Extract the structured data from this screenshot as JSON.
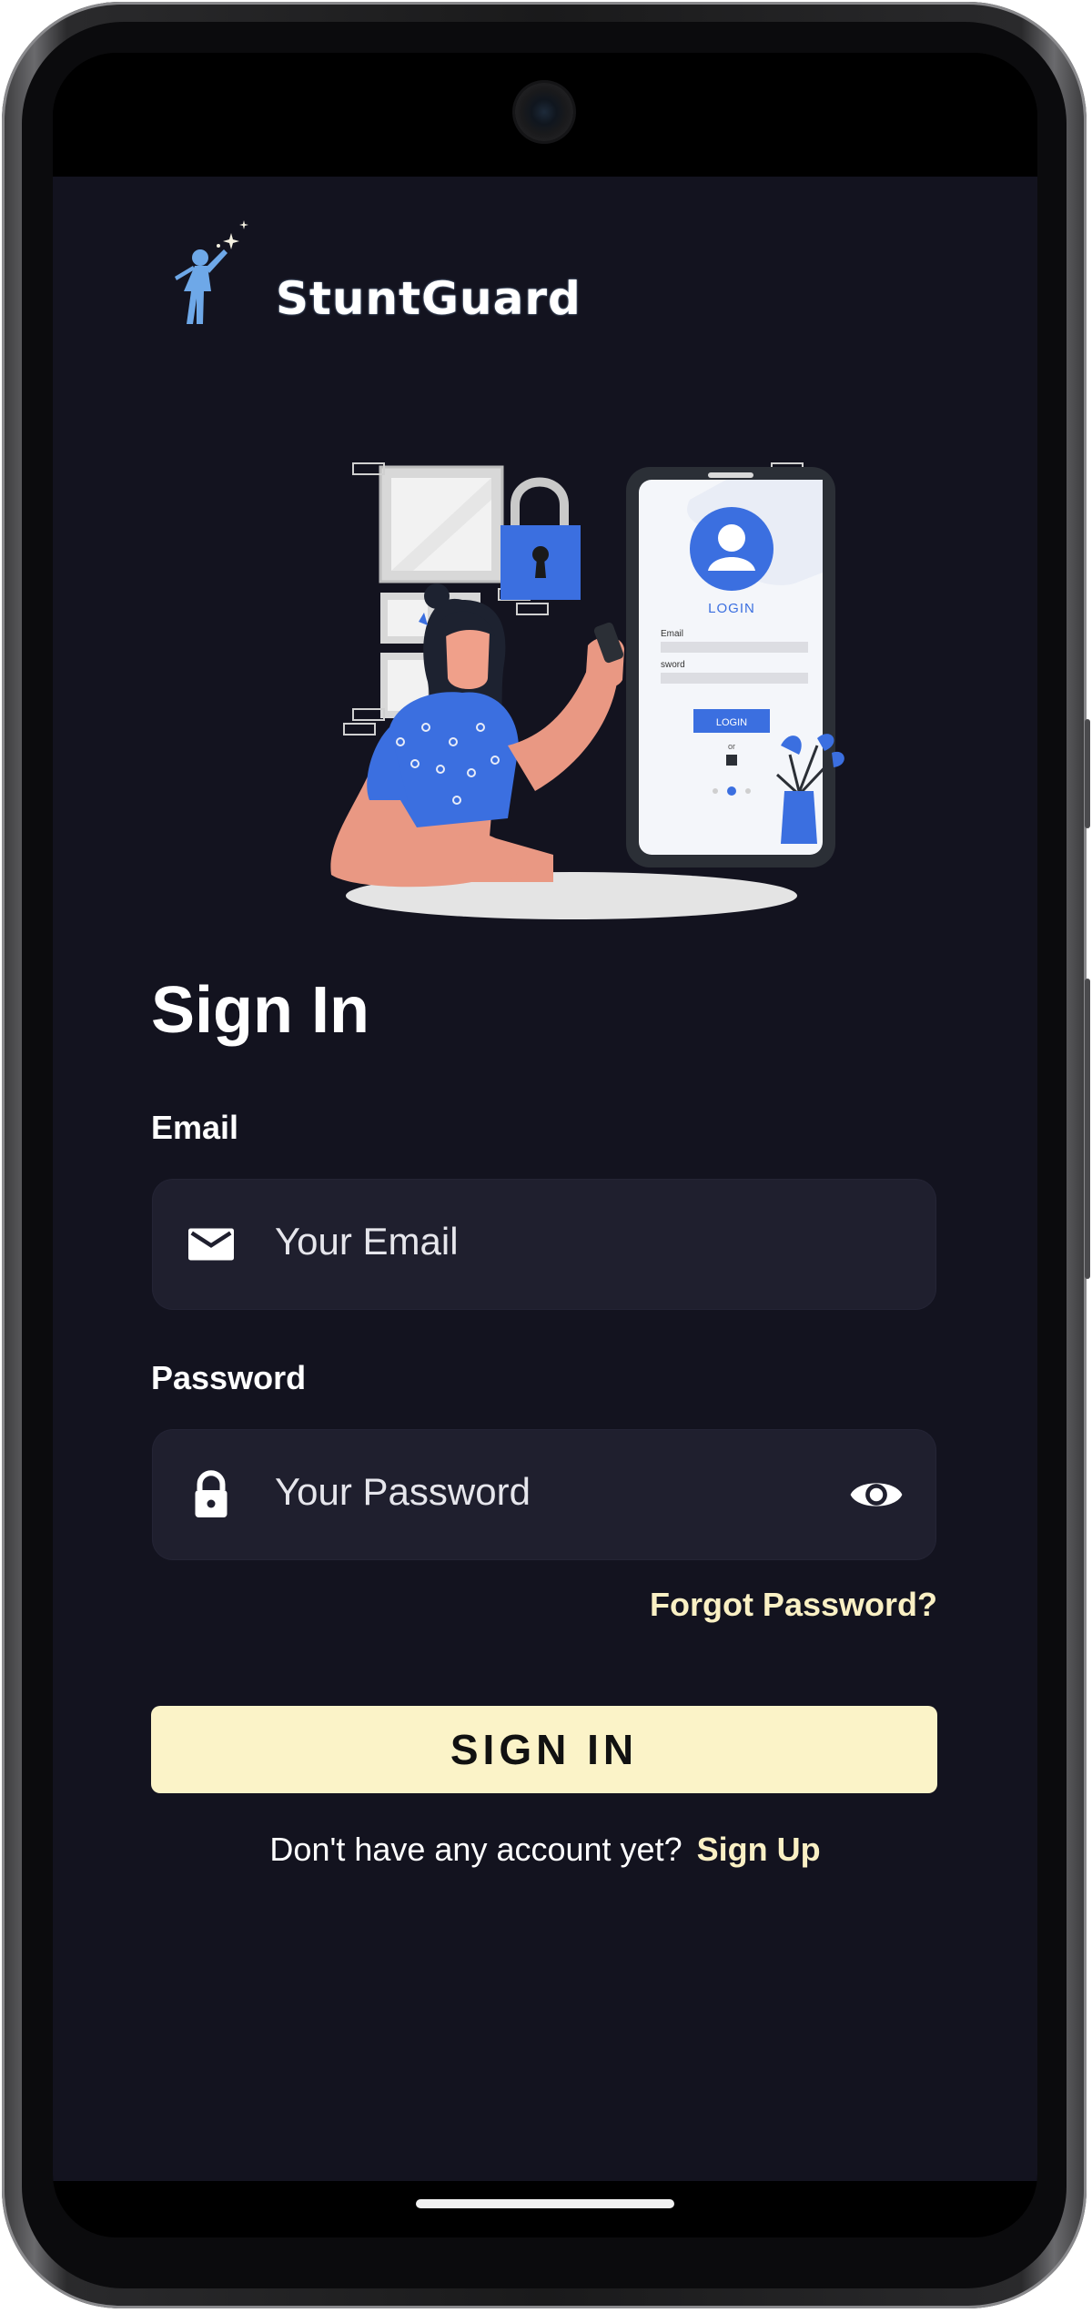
{
  "app": {
    "brand_name": "StuntGuard",
    "colors": {
      "background": "#13131f",
      "input_background": "#1f1f2e",
      "accent": "#fbf3c8",
      "illustration_blue": "#3b6fe0"
    }
  },
  "illustration": {
    "phone_login_label": "LOGIN",
    "phone_email_label": "Email",
    "phone_password_label": "sword",
    "phone_button_label": "LOGIN",
    "phone_or_label": "or"
  },
  "signin": {
    "title": "Sign In",
    "email_label": "Email",
    "email_placeholder": "Your Email",
    "email_value": "",
    "email_icon": "envelope-icon",
    "password_label": "Password",
    "password_placeholder": "Your Password",
    "password_value": "",
    "password_icon": "lock-icon",
    "visibility_icon": "eye-icon",
    "forgot_password": "Forgot Password?",
    "button_label": "SIGN IN",
    "no_account_text": "Don't have any account yet?",
    "signup_link": "Sign Up"
  }
}
